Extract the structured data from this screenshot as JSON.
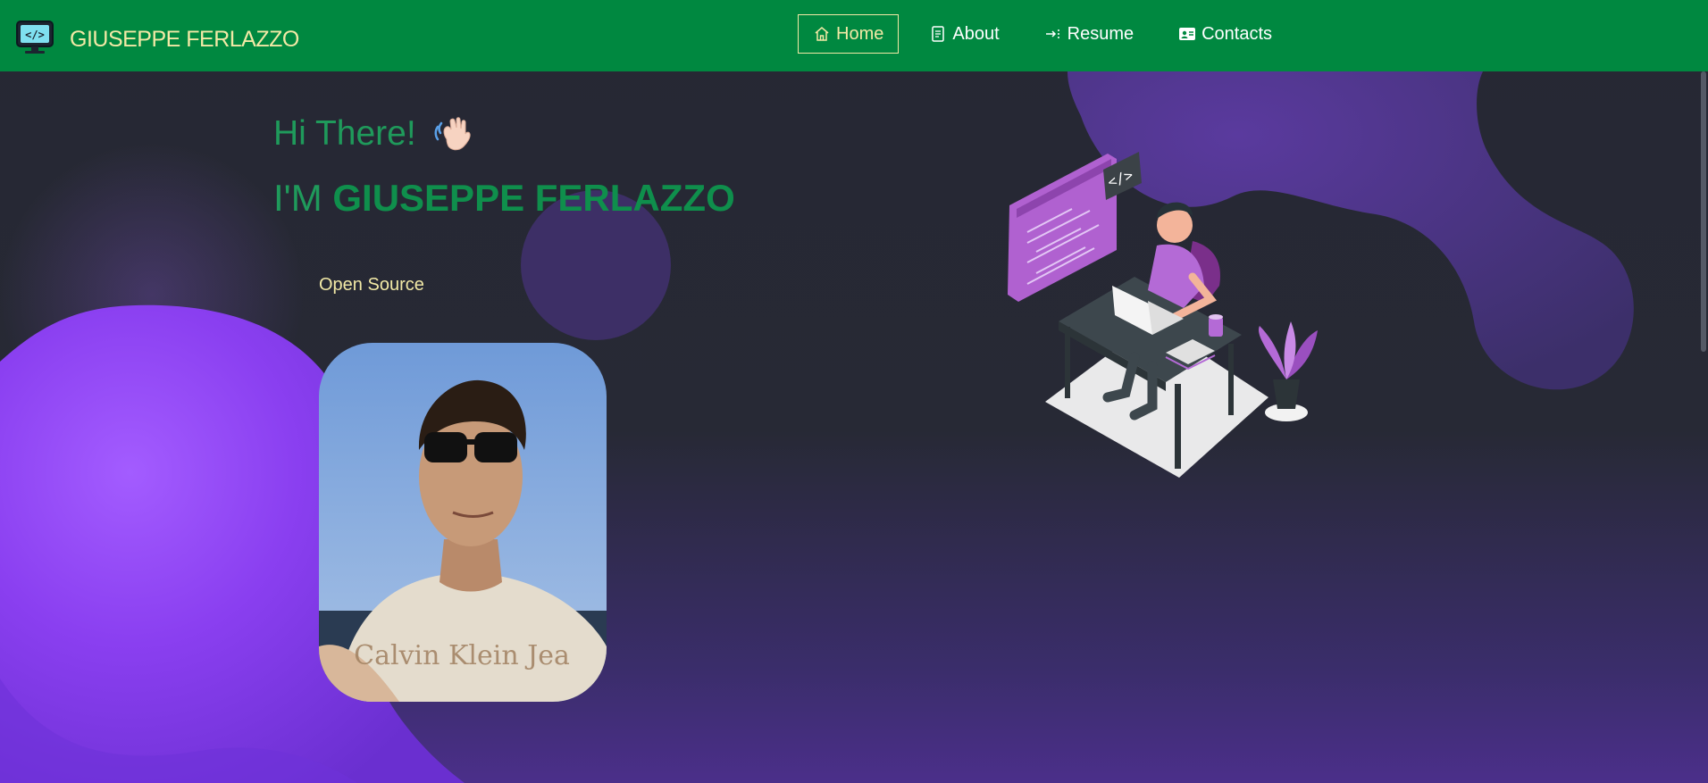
{
  "brand": {
    "name": "GIUSEPPE FERLAZZO",
    "icon": "code-monitor-icon"
  },
  "nav": {
    "items": [
      {
        "label": "Home",
        "icon": "home-icon",
        "active": true
      },
      {
        "label": "About",
        "icon": "document-icon",
        "active": false
      },
      {
        "label": "Resume",
        "icon": "arrow-right-icon",
        "active": false
      },
      {
        "label": "Contacts",
        "icon": "contact-card-icon",
        "active": false
      }
    ]
  },
  "hero": {
    "greeting": "Hi There!",
    "intro_prefix": "I'M",
    "name": "GIUSEPPE FERLAZZO",
    "typed_text": "Open Source"
  },
  "colors": {
    "navbar": "#008840",
    "accent_green": "#1f9a5b",
    "brand_yellow": "#f2e9a6",
    "background": "#262833",
    "purple_blob": "#7c3aed"
  }
}
